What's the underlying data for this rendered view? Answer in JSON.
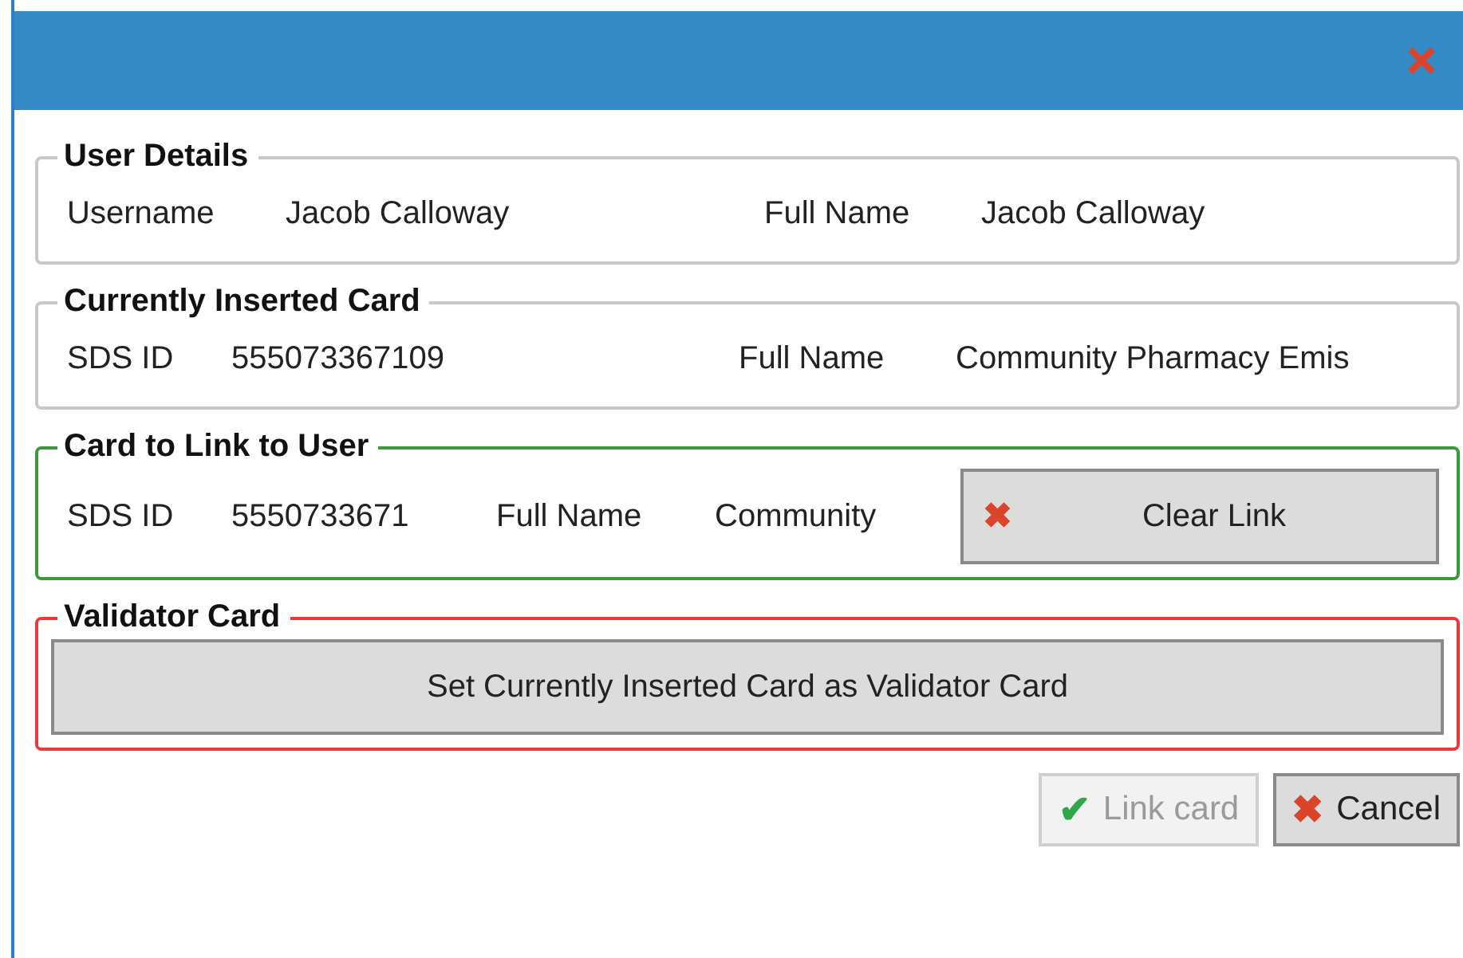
{
  "groups": [
    {
      "title": "User Details",
      "color": "#c8c8c8",
      "fields": [
        {
          "label": "Username",
          "value": "Jacob Calloway"
        },
        {
          "label": "Full Name",
          "value": "Jacob Calloway"
        }
      ]
    },
    {
      "title": "Currently Inserted Card",
      "color": "#c8c8c8",
      "fields": [
        {
          "label": "SDS ID",
          "value": "555073367109"
        },
        {
          "label": "Full Name",
          "value": "Community Pharmacy Emis"
        }
      ]
    },
    {
      "title": "Card to Link to User",
      "color": "#3a9a3a",
      "fields": [
        {
          "label": "SDS ID",
          "value": "5550733671"
        },
        {
          "label": "Full Name",
          "value": "Community"
        }
      ],
      "button": {
        "label": "Clear Link",
        "icon": "✖"
      }
    },
    {
      "title": "Validator Card",
      "color": "#e83a3a",
      "button": {
        "label": "Set Currently Inserted Card as Validator Card"
      }
    }
  ],
  "footer": [
    {
      "label": "Link card",
      "icon": "✔",
      "kind": "confirm",
      "disabled": true
    },
    {
      "label": "Cancel",
      "icon": "✖",
      "kind": "cancel",
      "disabled": false
    }
  ]
}
